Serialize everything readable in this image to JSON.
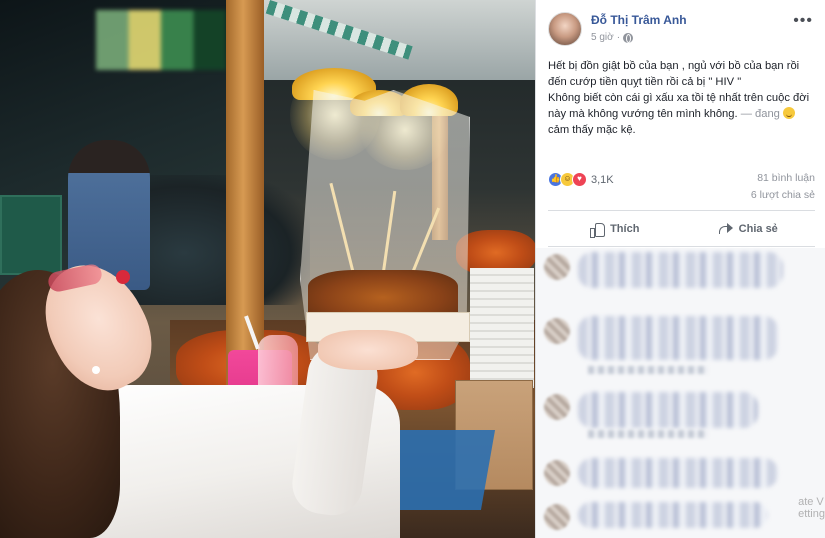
{
  "post": {
    "author_name": "Đỗ Thị Trâm Anh",
    "timestamp": "5 giờ",
    "menu_icon": "more-dots-icon",
    "privacy_icon": "globe-icon",
    "text_lines": [
      "Hết bị đồn giật bồ của bạn , ngủ với bồ của bạn rồi",
      "đến cướp tiền quỵt tiền rồi cả bị \" HIV \"",
      "Không biết còn cái gì xấu xa tồi tệ nhất trên cuộc đời",
      "này mà không vướng tên mình không."
    ],
    "tag_prefix": "— đang",
    "feeling_text": "cảm thấy mặc kệ."
  },
  "stats": {
    "reaction_count": "3,1K",
    "reactions": [
      "like",
      "haha",
      "love"
    ],
    "comments": "81 bình luận",
    "shares": "6 lượt chia sẻ"
  },
  "actions": {
    "like_label": "Thích",
    "share_label": "Chia sẻ"
  },
  "watermark": "ate V",
  "watermark2": "etting"
}
